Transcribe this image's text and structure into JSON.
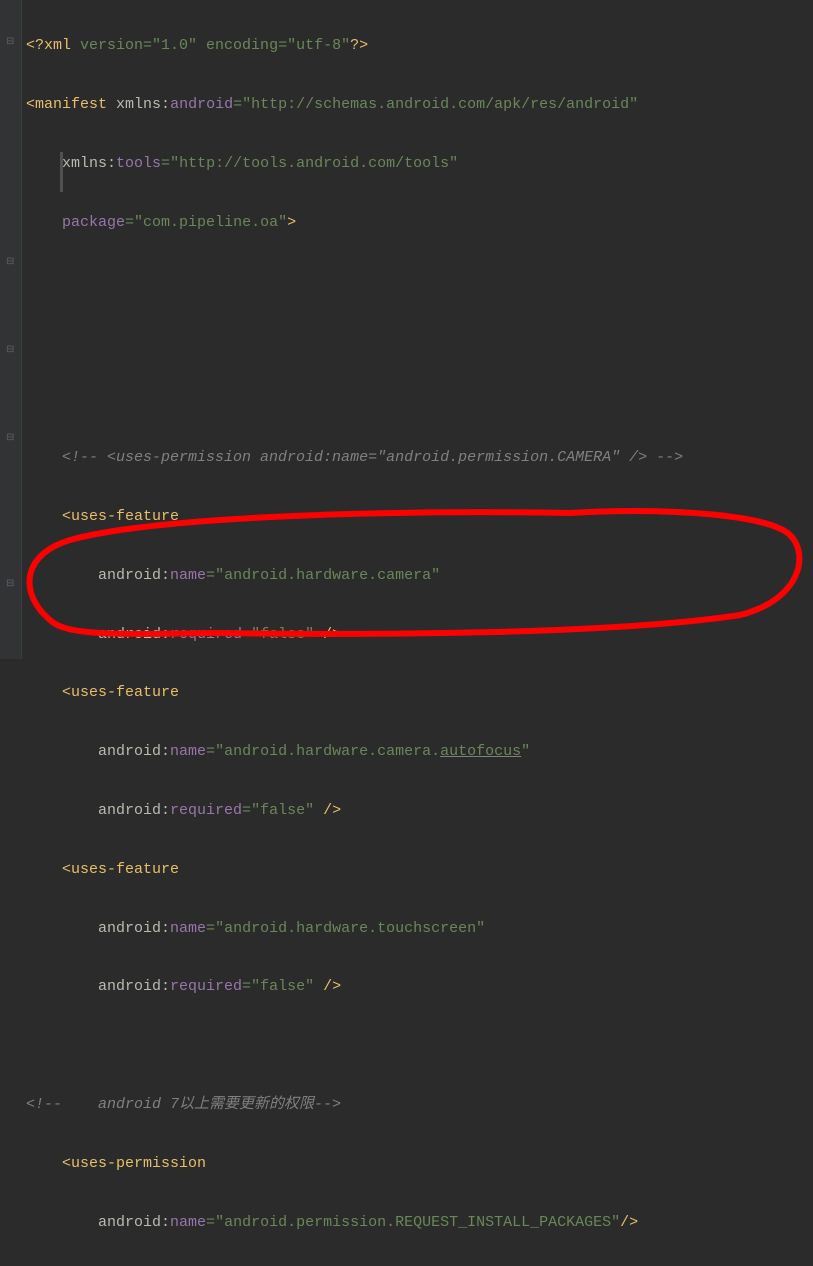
{
  "xml_decl": {
    "open": "<?",
    "name": "xml",
    "attrs": " version=\"1.0\" encoding=\"utf-8\"",
    "close": "?>"
  },
  "manifest": {
    "open": "<",
    "tag": "manifest",
    "sp": " ",
    "a1_ns": "xmlns:",
    "a1_name": "android",
    "a1_eq": "=",
    "a1_val": "\"http://schemas.android.com/apk/res/android\"",
    "a2_ns": "xmlns:",
    "a2_name": "tools",
    "a2_eq": "=",
    "a2_val": "\"http://tools.android.com/tools\"",
    "a3_ns": "",
    "a3_name": "package",
    "a3_eq": "=",
    "a3_val": "\"com.pipeline.oa\"",
    "close": ">"
  },
  "comment1": "<!-- <uses-permission android:name=\"android.permission.CAMERA\" /> -->",
  "uf1": {
    "open": "<",
    "tag": "uses-feature",
    "a1_ns": "android:",
    "a1_name": "name",
    "a1_eq": "=",
    "a1_val": "\"android.hardware.camera\"",
    "a2_ns": "android:",
    "a2_name": "required",
    "a2_eq": "=",
    "a2_val": "\"false\"",
    "close": " />"
  },
  "uf2": {
    "open": "<",
    "tag": "uses-feature",
    "a1_ns": "android:",
    "a1_name": "name",
    "a1_eq": "=",
    "a1_val_pre": "\"android.hardware.camera.",
    "a1_val_under": "autofocus",
    "a1_val_post": "\"",
    "a2_ns": "android:",
    "a2_name": "required",
    "a2_eq": "=",
    "a2_val": "\"false\"",
    "close": " />"
  },
  "uf3": {
    "open": "<",
    "tag": "uses-feature",
    "a1_ns": "android:",
    "a1_name": "name",
    "a1_eq": "=",
    "a1_val": "\"android.hardware.touchscreen\"",
    "a2_ns": "android:",
    "a2_name": "required",
    "a2_eq": "=",
    "a2_val": "\"false\"",
    "close": " />"
  },
  "comment2_pre": "<!--    ",
  "comment2_txt": "android 7以上需要更新的权限",
  "comment2_post": "-->",
  "up": {
    "open": "<",
    "tag": "uses-permission",
    "a1_ns": "android:",
    "a1_name": "name",
    "a1_eq": "=",
    "a1_val": "\"android.permission.REQUEST_INSTALL_PACKAGES\"",
    "close": "/>"
  },
  "indent1": "    ",
  "indent2": "        "
}
